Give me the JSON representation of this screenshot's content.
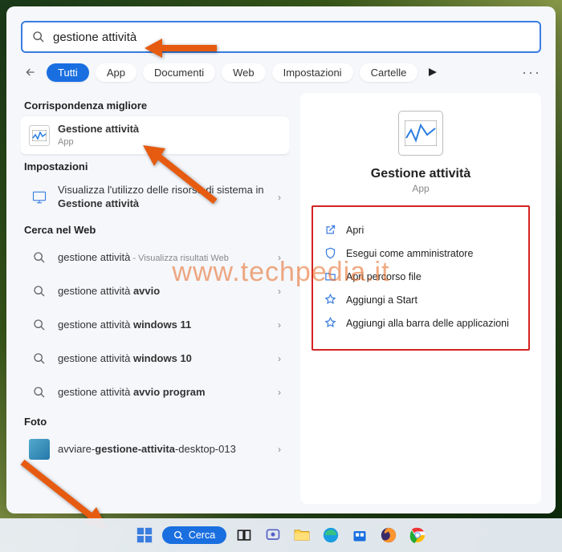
{
  "search": {
    "value": "gestione attività"
  },
  "filters": {
    "items": [
      {
        "label": "Tutti",
        "active": true
      },
      {
        "label": "App"
      },
      {
        "label": "Documenti"
      },
      {
        "label": "Web"
      },
      {
        "label": "Impostazioni"
      },
      {
        "label": "Cartelle"
      }
    ]
  },
  "sections": {
    "best": "Corrispondenza migliore",
    "settings": "Impostazioni",
    "web": "Cerca nel Web",
    "photos": "Foto"
  },
  "best_match": {
    "title": "Gestione attività",
    "sub": "App"
  },
  "settings_items": [
    {
      "pre": "Visualizza l'utilizzo delle risorse di sistema in ",
      "bold": "Gestione attività"
    }
  ],
  "web_items": [
    {
      "pre": "gestione attività",
      "suffix": " - Visualizza risultati Web"
    },
    {
      "pre": "gestione attività ",
      "bold": "avvio"
    },
    {
      "pre": "gestione attività ",
      "bold": "windows 11"
    },
    {
      "pre": "gestione attività ",
      "bold": "windows 10"
    },
    {
      "pre": "gestione attività ",
      "bold": "avvio program"
    }
  ],
  "photos_items": [
    {
      "pre": "avviare-",
      "bold": "gestione-attivita",
      "post": "-desktop-013"
    }
  ],
  "preview": {
    "title": "Gestione attività",
    "category": "App",
    "actions": [
      "Apri",
      "Esegui come amministratore",
      "Apri percorso file",
      "Aggiungi a Start",
      "Aggiungi alla barra delle applicazioni"
    ]
  },
  "taskbar": {
    "search_label": "Cerca"
  },
  "watermark": "www.techpedia.it"
}
